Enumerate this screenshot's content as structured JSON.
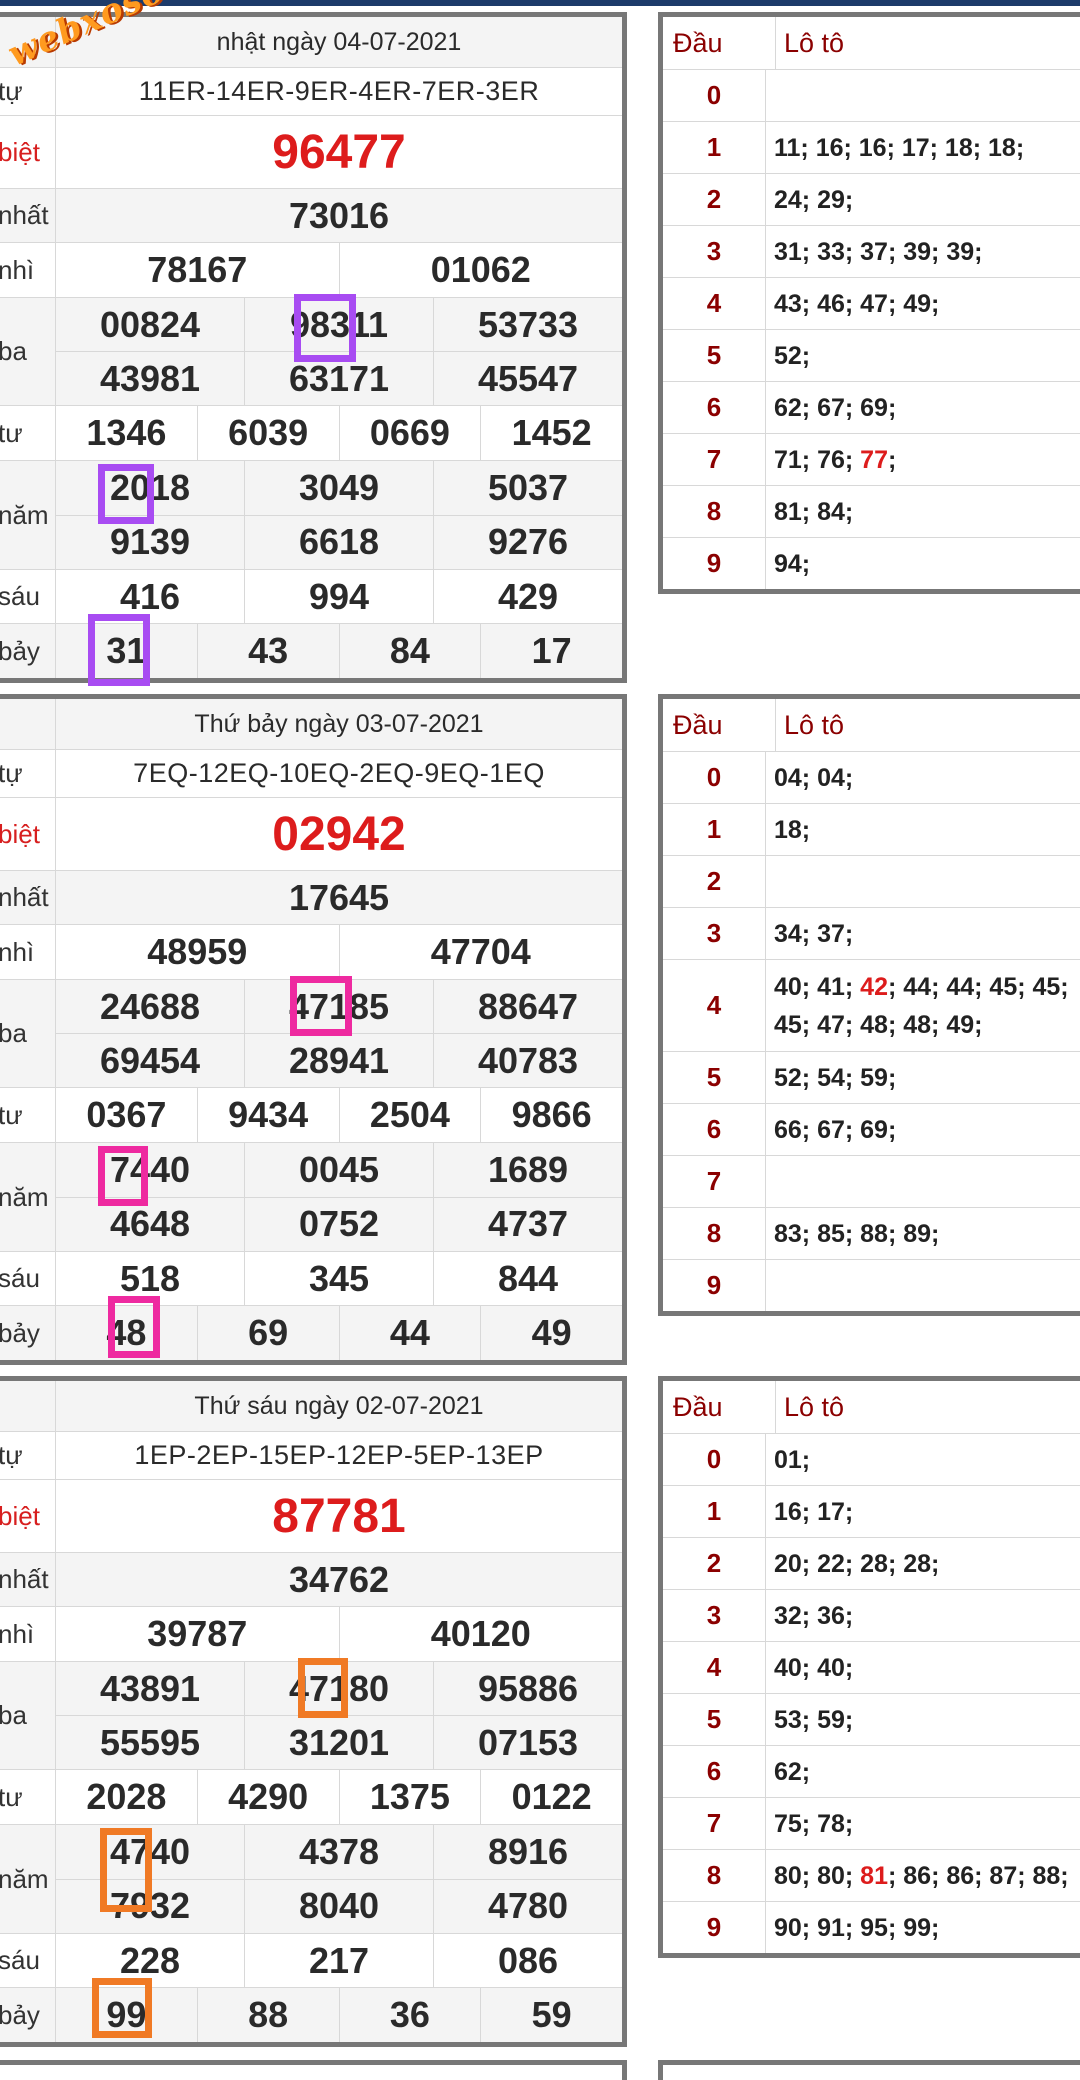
{
  "brand": {
    "watermark": "webxoso.net"
  },
  "colors": {
    "jackpot": "#dd1c1c",
    "dau": "#8b0000",
    "hl1": "#a84cf2",
    "hl2": "#ee2aa0",
    "hl3": "#f07a25"
  },
  "blocks": [
    {
      "title": "nhật ngày 04-07-2021",
      "code_label": "tự",
      "code": "11ER-14ER-9ER-4ER-7ER-3ER",
      "prizes": {
        "db": {
          "label": "biệt",
          "values": [
            "96477"
          ]
        },
        "g1": {
          "label": "nhất",
          "values": [
            "73016"
          ]
        },
        "g2": {
          "label": "nhì",
          "values": [
            "78167",
            "01062"
          ]
        },
        "g3": {
          "label": "ba",
          "values": [
            "00824",
            "98311",
            "53733",
            "43981",
            "63171",
            "45547"
          ]
        },
        "g4": {
          "label": "tư",
          "values": [
            "1346",
            "6039",
            "0669",
            "1452"
          ]
        },
        "g5": {
          "label": "năm",
          "values": [
            "2018",
            "3049",
            "5037",
            "9139",
            "6618",
            "9276"
          ]
        },
        "g6": {
          "label": "sáu",
          "values": [
            "416",
            "994",
            "429"
          ]
        },
        "g7": {
          "label": "bảy",
          "values": [
            "31",
            "43",
            "84",
            "17"
          ]
        }
      },
      "loto_header": {
        "dau": "Đầu",
        "loto": "Lô tô"
      },
      "loto": [
        {
          "dau": "0",
          "parts": []
        },
        {
          "dau": "1",
          "parts": [
            {
              "t": "11; 16; 16; 17; 18; 18;"
            }
          ]
        },
        {
          "dau": "2",
          "parts": [
            {
              "t": "24; 29;"
            }
          ]
        },
        {
          "dau": "3",
          "parts": [
            {
              "t": "31; 33; 37; 39; 39;"
            }
          ]
        },
        {
          "dau": "4",
          "parts": [
            {
              "t": "43; 46; 47; 49;"
            }
          ]
        },
        {
          "dau": "5",
          "parts": [
            {
              "t": "52;"
            }
          ]
        },
        {
          "dau": "6",
          "parts": [
            {
              "t": "62; 67; 69;"
            }
          ]
        },
        {
          "dau": "7",
          "parts": [
            {
              "t": "71; 76; "
            },
            {
              "t": "77",
              "red": true
            },
            {
              "t": ";"
            }
          ]
        },
        {
          "dau": "8",
          "parts": [
            {
              "t": "81; 84;"
            }
          ]
        },
        {
          "dau": "9",
          "parts": [
            {
              "t": "94;"
            }
          ]
        }
      ]
    },
    {
      "title": "Thứ bảy ngày 03-07-2021",
      "code_label": "tự",
      "code": "7EQ-12EQ-10EQ-2EQ-9EQ-1EQ",
      "prizes": {
        "db": {
          "label": "biệt",
          "values": [
            "02942"
          ]
        },
        "g1": {
          "label": "nhất",
          "values": [
            "17645"
          ]
        },
        "g2": {
          "label": "nhì",
          "values": [
            "48959",
            "47704"
          ]
        },
        "g3": {
          "label": "ba",
          "values": [
            "24688",
            "47185",
            "88647",
            "69454",
            "28941",
            "40783"
          ]
        },
        "g4": {
          "label": "tư",
          "values": [
            "0367",
            "9434",
            "2504",
            "9866"
          ]
        },
        "g5": {
          "label": "năm",
          "values": [
            "7440",
            "0045",
            "1689",
            "4648",
            "0752",
            "4737"
          ]
        },
        "g6": {
          "label": "sáu",
          "values": [
            "518",
            "345",
            "844"
          ]
        },
        "g7": {
          "label": "bảy",
          "values": [
            "48",
            "69",
            "44",
            "49"
          ]
        }
      },
      "loto_header": {
        "dau": "Đầu",
        "loto": "Lô tô"
      },
      "loto": [
        {
          "dau": "0",
          "parts": [
            {
              "t": "04; 04;"
            }
          ]
        },
        {
          "dau": "1",
          "parts": [
            {
              "t": "18;"
            }
          ]
        },
        {
          "dau": "2",
          "parts": []
        },
        {
          "dau": "3",
          "parts": [
            {
              "t": "34; 37;"
            }
          ]
        },
        {
          "dau": "4",
          "parts": [
            {
              "t": "40; 41; "
            },
            {
              "t": "42",
              "red": true
            },
            {
              "t": "; 44; 44; 45; 45; 45; 47; 48; 48; 49;"
            }
          ]
        },
        {
          "dau": "5",
          "parts": [
            {
              "t": "52; 54; 59;"
            }
          ]
        },
        {
          "dau": "6",
          "parts": [
            {
              "t": "66; 67; 69;"
            }
          ]
        },
        {
          "dau": "7",
          "parts": []
        },
        {
          "dau": "8",
          "parts": [
            {
              "t": "83; 85; 88; 89;"
            }
          ]
        },
        {
          "dau": "9",
          "parts": []
        }
      ]
    },
    {
      "title": "Thứ sáu ngày 02-07-2021",
      "code_label": "tự",
      "code": "1EP-2EP-15EP-12EP-5EP-13EP",
      "prizes": {
        "db": {
          "label": "biệt",
          "values": [
            "87781"
          ]
        },
        "g1": {
          "label": "nhất",
          "values": [
            "34762"
          ]
        },
        "g2": {
          "label": "nhì",
          "values": [
            "39787",
            "40120"
          ]
        },
        "g3": {
          "label": "ba",
          "values": [
            "43891",
            "47180",
            "95886",
            "55595",
            "31201",
            "07153"
          ]
        },
        "g4": {
          "label": "tư",
          "values": [
            "2028",
            "4290",
            "1375",
            "0122"
          ]
        },
        "g5": {
          "label": "năm",
          "values": [
            "4740",
            "4378",
            "8916",
            "7932",
            "8040",
            "4780"
          ]
        },
        "g6": {
          "label": "sáu",
          "values": [
            "228",
            "217",
            "086"
          ]
        },
        "g7": {
          "label": "bảy",
          "values": [
            "99",
            "88",
            "36",
            "59"
          ]
        }
      },
      "loto_header": {
        "dau": "Đầu",
        "loto": "Lô tô"
      },
      "loto": [
        {
          "dau": "0",
          "parts": [
            {
              "t": "01;"
            }
          ]
        },
        {
          "dau": "1",
          "parts": [
            {
              "t": "16; 17;"
            }
          ]
        },
        {
          "dau": "2",
          "parts": [
            {
              "t": "20; 22; 28; 28;"
            }
          ]
        },
        {
          "dau": "3",
          "parts": [
            {
              "t": "32; 36;"
            }
          ]
        },
        {
          "dau": "4",
          "parts": [
            {
              "t": "40; 40;"
            }
          ]
        },
        {
          "dau": "5",
          "parts": [
            {
              "t": "53; 59;"
            }
          ]
        },
        {
          "dau": "6",
          "parts": [
            {
              "t": "62;"
            }
          ]
        },
        {
          "dau": "7",
          "parts": [
            {
              "t": "75; 78;"
            }
          ]
        },
        {
          "dau": "8",
          "parts": [
            {
              "t": "80; 80; "
            },
            {
              "t": "81",
              "red": true
            },
            {
              "t": "; 86; 86; 87; 88;"
            }
          ]
        },
        {
          "dau": "9",
          "parts": [
            {
              "t": "90; 91; 95; 99;"
            }
          ]
        }
      ]
    }
  ]
}
